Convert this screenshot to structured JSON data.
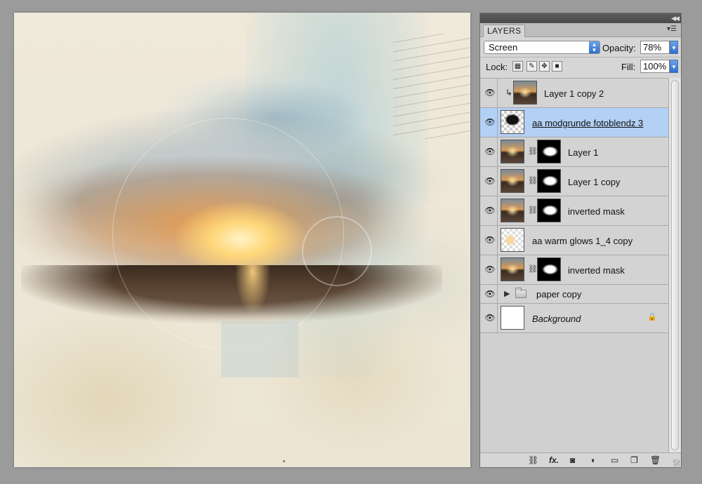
{
  "panel": {
    "tab_label": "LAYERS",
    "blend_mode": "Screen",
    "opacity_label": "Opacity:",
    "opacity_value": "78%",
    "lock_label": "Lock:",
    "fill_label": "Fill:",
    "fill_value": "100%"
  },
  "layers": [
    {
      "name": "Layer 1 copy 2",
      "thumb": "photo",
      "clipped": true,
      "has_mask": false,
      "visible": true
    },
    {
      "name": "aa modgrunde fotoblendz 3",
      "thumb": "brush",
      "selected": true,
      "has_mask": false,
      "visible": true
    },
    {
      "name": "Layer 1",
      "thumb": "photo",
      "has_mask": true,
      "visible": true
    },
    {
      "name": "Layer 1 copy",
      "thumb": "photo",
      "has_mask": true,
      "visible": true
    },
    {
      "name": "inverted mask",
      "thumb": "photo",
      "has_mask": true,
      "visible": true
    },
    {
      "name": "aa warm glows 1_4 copy",
      "thumb": "glow",
      "has_mask": false,
      "visible": true
    },
    {
      "name": "inverted mask",
      "thumb": "photo",
      "has_mask": true,
      "visible": true
    },
    {
      "name": "paper copy",
      "type": "group",
      "visible": true
    },
    {
      "name": "Background",
      "thumb": "white",
      "locked": true,
      "italic": true,
      "visible": true
    }
  ],
  "icons": {
    "eye": "eye-icon",
    "chain": "link-icon",
    "lock": "lock-icon"
  },
  "colors": {
    "selected_row": "#b3d0f5",
    "panel_bg": "#d6d6d6",
    "accent_blue": "#2f6fd1"
  }
}
